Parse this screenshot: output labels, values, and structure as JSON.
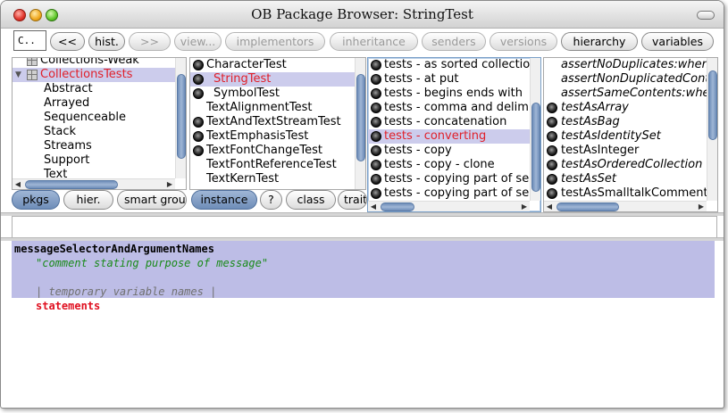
{
  "window": {
    "title": "OB Package Browser: StringTest"
  },
  "toolbar": {
    "search_value": "C..",
    "buttons": [
      {
        "label": "<<",
        "enabled": true
      },
      {
        "label": "hist.",
        "enabled": true
      },
      {
        "label": ">>",
        "enabled": false
      },
      {
        "label": "view...",
        "enabled": false
      },
      {
        "label": "implementors",
        "enabled": false
      },
      {
        "label": "inheritance",
        "enabled": false
      },
      {
        "label": "senders",
        "enabled": false
      },
      {
        "label": "versions",
        "enabled": false
      },
      {
        "label": "hierarchy",
        "enabled": true
      },
      {
        "label": "variables",
        "enabled": true
      }
    ]
  },
  "packages": {
    "items": [
      {
        "label": "Collections-Weak",
        "level": 0,
        "icon": "package-icon"
      },
      {
        "label": "CollectionsTests",
        "level": 0,
        "icon": "package-icon",
        "expanded": true,
        "selected": true
      },
      {
        "label": "Abstract",
        "level": 1
      },
      {
        "label": "Arrayed",
        "level": 1
      },
      {
        "label": "Sequenceable",
        "level": 1
      },
      {
        "label": "Stack",
        "level": 1
      },
      {
        "label": "Streams",
        "level": 1
      },
      {
        "label": "Support",
        "level": 1
      },
      {
        "label": "Text",
        "level": 1
      }
    ],
    "switches": [
      {
        "label": "pkgs",
        "active": true
      },
      {
        "label": "hier.",
        "active": false
      },
      {
        "label": "smart groups",
        "active": false
      }
    ]
  },
  "classes": {
    "items": [
      {
        "label": "CharacterTest",
        "dot": true,
        "indent": 0
      },
      {
        "label": "StringTest",
        "dot": true,
        "indent": 1,
        "selected": true
      },
      {
        "label": "SymbolTest",
        "dot": true,
        "indent": 1
      },
      {
        "label": "TextAlignmentTest",
        "dot": false,
        "indent": 0
      },
      {
        "label": "TextAndTextStreamTest",
        "dot": true,
        "indent": 0
      },
      {
        "label": "TextEmphasisTest",
        "dot": true,
        "indent": 0
      },
      {
        "label": "TextFontChangeTest",
        "dot": true,
        "indent": 0
      },
      {
        "label": "TextFontReferenceTest",
        "dot": false,
        "indent": 0
      },
      {
        "label": "TextKernTest",
        "dot": false,
        "indent": 0
      }
    ],
    "switches": [
      {
        "label": "instance",
        "active": true
      },
      {
        "label": "?",
        "active": false
      },
      {
        "label": "class",
        "active": false
      },
      {
        "label": "trait",
        "active": false
      }
    ]
  },
  "protocols": {
    "items": [
      {
        "label": "tests - as sorted collection",
        "selected": false
      },
      {
        "label": "tests - at put",
        "selected": false
      },
      {
        "label": "tests - begins ends with",
        "selected": false
      },
      {
        "label": "tests - comma and delimiter",
        "selected": false
      },
      {
        "label": "tests - concatenation",
        "selected": false
      },
      {
        "label": "tests - converting",
        "selected": true
      },
      {
        "label": "tests - copy",
        "selected": false
      },
      {
        "label": "tests - copy - clone",
        "selected": false
      },
      {
        "label": "tests - copying part of sequenceable",
        "selected": false
      },
      {
        "label": "tests - copying part of sequenceable for multiply",
        "selected": false
      }
    ]
  },
  "methods": {
    "items": [
      {
        "label": "assertNoDuplicates:whenConvertedTo:",
        "dot": false,
        "italic": true
      },
      {
        "label": "assertNonDuplicatedContents:whenConverted:",
        "dot": false,
        "italic": true
      },
      {
        "label": "assertSameContents:whenConvertedTo:",
        "dot": false,
        "italic": true
      },
      {
        "label": "testAsArray",
        "dot": true,
        "italic": true
      },
      {
        "label": "testAsBag",
        "dot": true,
        "italic": true
      },
      {
        "label": "testAsIdentitySet",
        "dot": true,
        "italic": true
      },
      {
        "label": "testAsInteger",
        "dot": true,
        "italic": false
      },
      {
        "label": "testAsOrderedCollection",
        "dot": true,
        "italic": true
      },
      {
        "label": "testAsSet",
        "dot": true,
        "italic": true
      },
      {
        "label": "testAsSmalltalkComment",
        "dot": true,
        "italic": false
      }
    ]
  },
  "annotation": {
    "text": ""
  },
  "code": {
    "selector": "messageSelectorAndArgumentNames",
    "comment": "\"comment stating purpose of message\"",
    "temps": "| temporary variable names |",
    "statements": "statements"
  },
  "colors": {
    "selection": "#ccccec",
    "selected_text": "#e0202a",
    "code_selection": "#bdbde6",
    "comment": "#1a8a1a",
    "scroll_thumb": "#6e8db8"
  }
}
